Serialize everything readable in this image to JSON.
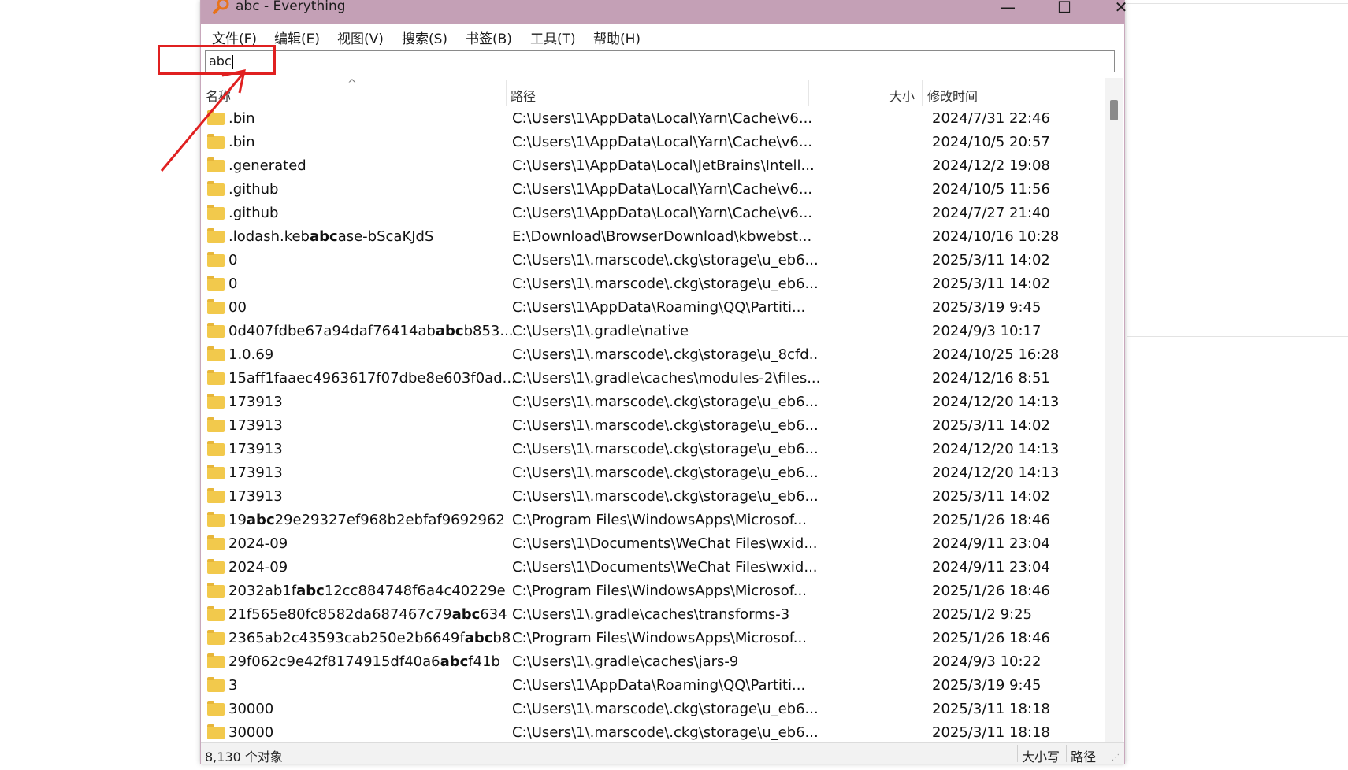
{
  "window": {
    "title": "abc - Everything",
    "minimize_glyph": "—",
    "maximize_glyph": "☐",
    "close_glyph": "✕"
  },
  "menu": [
    "文件(F)",
    "编辑(E)",
    "视图(V)",
    "搜索(S)",
    "书签(B)",
    "工具(T)",
    "帮助(H)"
  ],
  "search": {
    "value": "abc"
  },
  "columns": {
    "name": "名称",
    "path": "路径",
    "size": "大小",
    "modified": "修改时间"
  },
  "rows": [
    {
      "name_parts": [
        ".bin"
      ],
      "path": "C:\\Users\\1\\AppData\\Local\\Yarn\\Cache\\v6...",
      "date": "2024/7/31 22:46"
    },
    {
      "name_parts": [
        ".bin"
      ],
      "path": "C:\\Users\\1\\AppData\\Local\\Yarn\\Cache\\v6...",
      "date": "2024/10/5 20:57"
    },
    {
      "name_parts": [
        ".generated"
      ],
      "path": "C:\\Users\\1\\AppData\\Local\\JetBrains\\Intell...",
      "date": "2024/12/2 19:08"
    },
    {
      "name_parts": [
        ".github"
      ],
      "path": "C:\\Users\\1\\AppData\\Local\\Yarn\\Cache\\v6...",
      "date": "2024/10/5 11:56"
    },
    {
      "name_parts": [
        ".github"
      ],
      "path": "C:\\Users\\1\\AppData\\Local\\Yarn\\Cache\\v6...",
      "date": "2024/7/27 21:40"
    },
    {
      "name_parts": [
        ".lodash.keb",
        "abc",
        "ase-bScaKJdS"
      ],
      "path": "E:\\Download\\BrowserDownload\\kbwebst...",
      "date": "2024/10/16 10:28"
    },
    {
      "name_parts": [
        "0"
      ],
      "path": "C:\\Users\\1\\.marscode\\.ckg\\storage\\u_eb6...",
      "date": "2025/3/11 14:02"
    },
    {
      "name_parts": [
        "0"
      ],
      "path": "C:\\Users\\1\\.marscode\\.ckg\\storage\\u_eb6...",
      "date": "2025/3/11 14:02"
    },
    {
      "name_parts": [
        "00"
      ],
      "path": "C:\\Users\\1\\AppData\\Roaming\\QQ\\Partiti...",
      "date": "2025/3/19 9:45"
    },
    {
      "name_parts": [
        "0d407fdbe67a94daf76414ab",
        "abc",
        "b853..."
      ],
      "path": "C:\\Users\\1\\.gradle\\native",
      "date": "2024/9/3 10:17"
    },
    {
      "name_parts": [
        "1.0.69"
      ],
      "path": "C:\\Users\\1\\.marscode\\.ckg\\storage\\u_8cfd...",
      "date": "2024/10/25 16:28"
    },
    {
      "name_parts": [
        "15aff1faaec4963617f07dbe8e603f0ad..."
      ],
      "path": "C:\\Users\\1\\.gradle\\caches\\modules-2\\files...",
      "date": "2024/12/16 8:51"
    },
    {
      "name_parts": [
        "173913"
      ],
      "path": "C:\\Users\\1\\.marscode\\.ckg\\storage\\u_eb6...",
      "date": "2024/12/20 14:13"
    },
    {
      "name_parts": [
        "173913"
      ],
      "path": "C:\\Users\\1\\.marscode\\.ckg\\storage\\u_eb6...",
      "date": "2025/3/11 14:02"
    },
    {
      "name_parts": [
        "173913"
      ],
      "path": "C:\\Users\\1\\.marscode\\.ckg\\storage\\u_eb6...",
      "date": "2024/12/20 14:13"
    },
    {
      "name_parts": [
        "173913"
      ],
      "path": "C:\\Users\\1\\.marscode\\.ckg\\storage\\u_eb6...",
      "date": "2024/12/20 14:13"
    },
    {
      "name_parts": [
        "173913"
      ],
      "path": "C:\\Users\\1\\.marscode\\.ckg\\storage\\u_eb6...",
      "date": "2025/3/11 14:02"
    },
    {
      "name_parts": [
        "19",
        "abc",
        "29e29327ef968b2ebfaf9692962"
      ],
      "path": "C:\\Program Files\\WindowsApps\\Microsof...",
      "date": "2025/1/26 18:46"
    },
    {
      "name_parts": [
        "2024-09"
      ],
      "path": "C:\\Users\\1\\Documents\\WeChat Files\\wxid...",
      "date": "2024/9/11 23:04"
    },
    {
      "name_parts": [
        "2024-09"
      ],
      "path": "C:\\Users\\1\\Documents\\WeChat Files\\wxid...",
      "date": "2024/9/11 23:04"
    },
    {
      "name_parts": [
        "2032ab1f",
        "abc",
        "12cc884748f6a4c40229e"
      ],
      "path": "C:\\Program Files\\WindowsApps\\Microsof...",
      "date": "2025/1/26 18:46"
    },
    {
      "name_parts": [
        "21f565e80fc8582da687467c79",
        "abc",
        "634"
      ],
      "path": "C:\\Users\\1\\.gradle\\caches\\transforms-3",
      "date": "2025/1/2 9:25"
    },
    {
      "name_parts": [
        "2365ab2c43593cab250e2b6649f",
        "abc",
        "b8"
      ],
      "path": "C:\\Program Files\\WindowsApps\\Microsof...",
      "date": "2025/1/26 18:46"
    },
    {
      "name_parts": [
        "29f062c9e42f8174915df40a6",
        "abc",
        "f41b"
      ],
      "path": "C:\\Users\\1\\.gradle\\caches\\jars-9",
      "date": "2024/9/3 10:22"
    },
    {
      "name_parts": [
        "3"
      ],
      "path": "C:\\Users\\1\\AppData\\Roaming\\QQ\\Partiti...",
      "date": "2025/3/19 9:45"
    },
    {
      "name_parts": [
        "30000"
      ],
      "path": "C:\\Users\\1\\.marscode\\.ckg\\storage\\u_eb6...",
      "date": "2025/3/11 18:18"
    },
    {
      "name_parts": [
        "30000"
      ],
      "path": "C:\\Users\\1\\.marscode\\.ckg\\storage\\u_eb6...",
      "date": "2025/3/11 18:18"
    }
  ],
  "status": {
    "count": "8,130 个对象",
    "match_case": "大小写",
    "match_path": "路径"
  },
  "colors": {
    "titlebar": "#c4a0b6",
    "annotation": "#e02020",
    "folder": "#f2c94c"
  }
}
